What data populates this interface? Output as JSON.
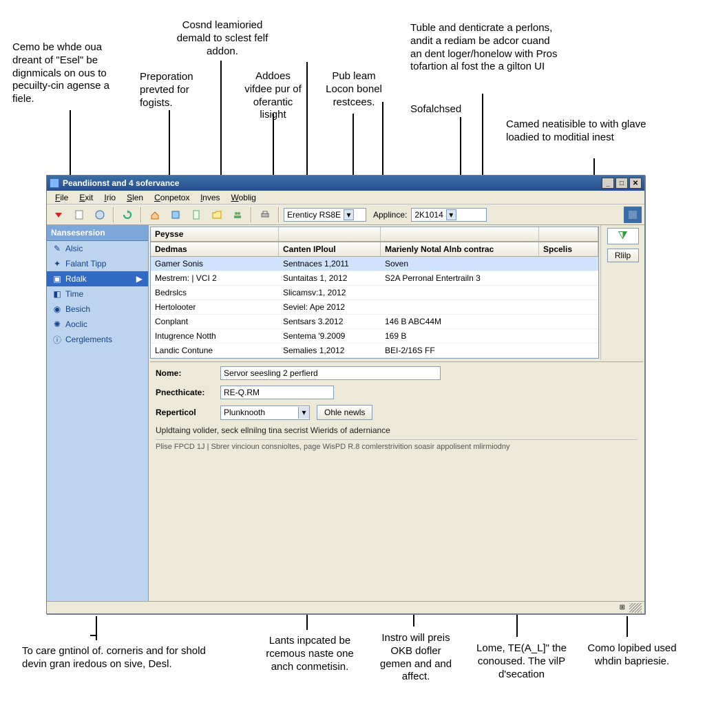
{
  "callouts": {
    "topA": "Cemo be whde oua dreant of \"Esel\" be dignmicals on ous to pecuilty-cin agense a fiele.",
    "topB": "Preporation prevted for fogists.",
    "topC": "Cosnd leamioried demald to sclest felf addon.",
    "topD": "Addoes vifdee pur of oferantic lisight",
    "topE": "Pub leam Locon bonel restcees.",
    "topF_a": "Tuble and denticrate a perlons, andit a rediam be adcor cuand an dent loger/honelow with Pros tofartion al fost the a gilton UI",
    "topF_b": "Sofalchsed",
    "topG": "Camed neatisible to with glave loadied to moditial inest",
    "botA": "To care gntinol of. corneris and for shold devin gran iredous on sive, Desl.",
    "botB": "Lants inpcated be rcemous naste one anch conmetisin.",
    "botC": "Instro will preis OKB dofler gemen and and affect.",
    "botD": "Lome, TE(A_L]\" the conoused. The vilP d'secation",
    "botE": "Como lopibed used whdin bapriesie."
  },
  "window": {
    "title": "Peandiionst and 4 sofervance"
  },
  "menu": {
    "items": [
      "File",
      "Exit",
      "Irio",
      "Slen",
      "Conpetox",
      "lnves",
      "Woblig"
    ]
  },
  "toolbar": {
    "combo1_label": "",
    "combo1_value": "Erenticy RS8E",
    "combo2_label": "Applince:",
    "combo2_value": "2K1014"
  },
  "sidebar": {
    "header": "Nansesersion",
    "items": [
      {
        "label": "Alsic"
      },
      {
        "label": "Falant Tipp"
      },
      {
        "label": "Rdalk",
        "selected": true
      },
      {
        "label": "Time"
      },
      {
        "label": "Besich"
      },
      {
        "label": "Aoclic"
      },
      {
        "label": "Cerglements"
      }
    ]
  },
  "table": {
    "columns": [
      "Peysse",
      "",
      "",
      " "
    ],
    "headers": [
      "Dedmas",
      "Canten IPloul",
      "Marienly Notal Alnb contrac",
      "Spcelis"
    ],
    "rows": [
      {
        "c0": "Gamer Sonis",
        "c1": "Sentnaces 1,2011",
        "c2": "Soven",
        "sel": true
      },
      {
        "c0": "Mestrem: | VCI 2",
        "c1": "Suntaitas 1, 2012",
        "c2": "S2A Perronal Entertrailn 3"
      },
      {
        "c0": "Bedrslcs",
        "c1": "Slicamsv:1, 2012",
        "c2": ""
      },
      {
        "c0": "Hertolooter",
        "c1": "Seviel: Ape 2012",
        "c2": ""
      },
      {
        "c0": "Conplant",
        "c1": "Sentsars 3.2012",
        "c2": "146 B ABC44M"
      },
      {
        "c0": "Intugrence Notth",
        "c1": "Sentema '9.2009",
        "c2": "169 B"
      },
      {
        "c0": "Landic Contune",
        "c1": "Semalies 1,2012",
        "c2": "BEI-2/16S FF"
      }
    ]
  },
  "aux": {
    "help": "Rlilp"
  },
  "detail": {
    "name_label": "Nome:",
    "name_value": "Servor seesling 2 perfierd",
    "pne_label": "Pnecthicate:",
    "pne_value": "RE-Q.RM",
    "rep_label": "Reperticol",
    "rep_value": "Plunknooth",
    "btn": "Ohle newls",
    "desc": "Upldtaing volider, seck ellnilng tina secrist Wierids of aderniance",
    "footer": "Plise FPCD 1J | Sbrer vincioun consnioltes, page WisPD R.8 comlerstrivition soasir appolisent mlirmiodny"
  }
}
